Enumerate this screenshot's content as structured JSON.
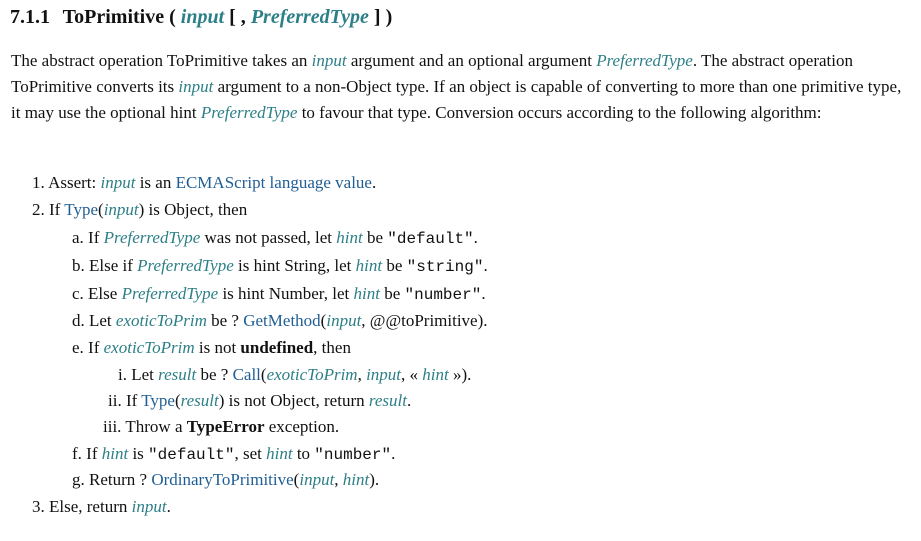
{
  "heading": {
    "number": "7.1.1",
    "name": "ToPrimitive",
    "open_paren": "(",
    "param1": "input",
    "open_bracket": "[ ,",
    "param2": "PreferredType",
    "close": "] )"
  },
  "intro": {
    "s1": "The abstract operation ToPrimitive takes an ",
    "v1": "input",
    "s2": " argument and an optional argument ",
    "v2": "PreferredType",
    "s3": ". The abstract operation ToPrimitive converts its ",
    "v3": "input",
    "s4": " argument to a non-Object type. If an object is capable of converting to more than one primitive type, it may use the optional hint ",
    "v4": "PreferredType",
    "s5": " to favour that type. Conversion occurs according to the following algorithm:"
  },
  "steps": {
    "s1": {
      "marker": "1.",
      "t1": "Assert: ",
      "v1": "input",
      "t2": " is an ",
      "l1": "ECMAScript language value",
      "t3": "."
    },
    "s2": {
      "marker": "2.",
      "t1": "If ",
      "l1": "Type",
      "t2": "(",
      "v1": "input",
      "t3": ") is Object, then"
    },
    "s2a": {
      "marker": "a.",
      "t1": "If ",
      "v1": "PreferredType",
      "t2": " was not passed, let ",
      "v2": "hint",
      "t3": " be ",
      "c1": "\"default\"",
      "t4": "."
    },
    "s2b": {
      "marker": "b.",
      "t1": "Else if ",
      "v1": "PreferredType",
      "t2": " is hint String, let ",
      "v2": "hint",
      "t3": " be ",
      "c1": "\"string\"",
      "t4": "."
    },
    "s2c": {
      "marker": "c.",
      "t1": "Else ",
      "v1": "PreferredType",
      "t2": " is hint Number, let ",
      "v2": "hint",
      "t3": " be ",
      "c1": "\"number\"",
      "t4": "."
    },
    "s2d": {
      "marker": "d.",
      "t1": "Let ",
      "v1": "exoticToPrim",
      "t2": " be ? ",
      "l1": "GetMethod",
      "t3": "(",
      "v2": "input",
      "t4": ", @@toPrimitive)."
    },
    "s2e": {
      "marker": "e.",
      "t1": "If ",
      "v1": "exoticToPrim",
      "t2": " is not ",
      "b1": "undefined",
      "t3": ", then"
    },
    "s2ei": {
      "marker": "i.",
      "t1": "Let ",
      "v1": "result",
      "t2": " be ? ",
      "l1": "Call",
      "t3": "(",
      "v2": "exoticToPrim",
      "t4": ", ",
      "v3": "input",
      "t5": ", « ",
      "v4": "hint",
      "t6": " »)."
    },
    "s2eii": {
      "marker": "ii.",
      "t1": "If ",
      "l1": "Type",
      "t2": "(",
      "v1": "result",
      "t3": ") is not Object, return ",
      "v2": "result",
      "t4": "."
    },
    "s2eiii": {
      "marker": "iii.",
      "t1": "Throw a ",
      "b1": "TypeError",
      "t2": " exception."
    },
    "s2f": {
      "marker": "f.",
      "t1": "If ",
      "v1": "hint",
      "t2": " is ",
      "c1": "\"default\"",
      "t3": ", set ",
      "v2": "hint",
      "t4": " to ",
      "c2": "\"number\"",
      "t5": "."
    },
    "s2g": {
      "marker": "g.",
      "t1": "Return ? ",
      "l1": "OrdinaryToPrimitive",
      "t2": "(",
      "v1": "input",
      "t3": ", ",
      "v2": "hint",
      "t4": ")."
    },
    "s3": {
      "marker": "3.",
      "t1": "Else, return ",
      "v1": "input",
      "t2": "."
    }
  },
  "colors": {
    "variable": "#2c7f86",
    "link": "#1f5e95",
    "text": "#111111"
  }
}
